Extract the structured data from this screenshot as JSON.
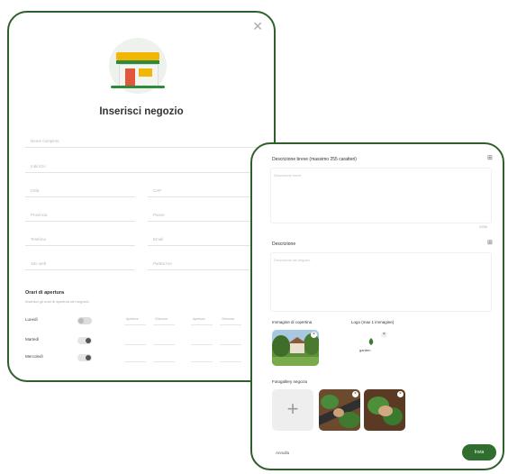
{
  "form": {
    "title": "Inserisci negozio",
    "fields": {
      "shop_name": "Nome completo",
      "address": "Indirizzo",
      "city": "Città",
      "postcode": "CAP",
      "province": "Provincia",
      "country": "Paese",
      "phone": "Telefono",
      "email": "Email",
      "website": "Sito web",
      "vat": "Partita IVA"
    },
    "hours_title": "Orari di apertura",
    "hours_subtitle": "Inserisci gli orari di apertura del negozio",
    "days": [
      {
        "label": "Lunedì",
        "open": false
      },
      {
        "label": "Martedì",
        "open": true
      },
      {
        "label": "Mercoledì",
        "open": true
      }
    ],
    "time_labels": [
      "Apertura",
      "Chiusura",
      "Apertura",
      "Chiusura"
    ]
  },
  "details": {
    "short_desc_label": "Descrizione breve (massimo 255 caratteri)",
    "short_desc_placeholder": "Descrizione breve",
    "short_desc_counter": "0/255",
    "desc_label": "Descrizione",
    "desc_placeholder": "Descrizione del negozio",
    "cover_label": "Immagine di copertina",
    "logo_label": "Logo (max 1 immagine)",
    "logo_text": "garden",
    "gallery_label": "Fotogallery negozio",
    "add_symbol": "+",
    "remove_symbol": "×",
    "cancel_label": "Annulla",
    "submit_label": "Invia"
  },
  "colors": {
    "border": "#2f5f2c",
    "accent": "#2f6e2d",
    "roof": "#f2b705",
    "door": "#e0573b"
  }
}
